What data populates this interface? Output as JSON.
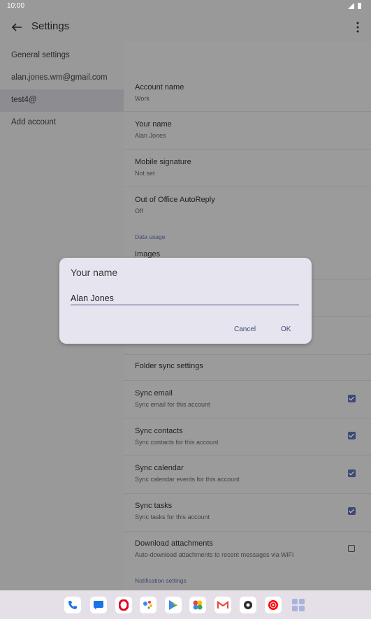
{
  "status": {
    "time": "10:00"
  },
  "appbar": {
    "title": "Settings"
  },
  "nav": {
    "items": [
      {
        "label": "General settings"
      },
      {
        "label": "alan.jones.wm@gmail.com"
      },
      {
        "label": "test4@"
      },
      {
        "label": "Add account"
      }
    ]
  },
  "settings": {
    "account_name": {
      "title": "Account name",
      "value": "Work"
    },
    "your_name": {
      "title": "Your name",
      "value": "Alan Jones"
    },
    "signature": {
      "title": "Mobile signature",
      "value": "Not set"
    },
    "autoreply": {
      "title": "Out of Office AutoReply",
      "value": "Off"
    },
    "data_usage_header": "Data usage",
    "images": {
      "title": "Images"
    },
    "folder_sync": {
      "title": "Folder sync settings"
    },
    "sync_email": {
      "title": "Sync email",
      "sub": "Sync email for this account",
      "checked": true
    },
    "sync_contacts": {
      "title": "Sync contacts",
      "sub": "Sync contacts for this account",
      "checked": true
    },
    "sync_calendar": {
      "title": "Sync calendar",
      "sub": "Sync calendar events for this account",
      "checked": true
    },
    "sync_tasks": {
      "title": "Sync tasks",
      "sub": "Sync tasks for this account",
      "checked": true
    },
    "download_attachments": {
      "title": "Download attachments",
      "sub": "Auto-download attachments to recent messages via WiFi",
      "checked": false
    },
    "notification_header": "Notification settings"
  },
  "dialog": {
    "title": "Your name",
    "input_value": "Alan Jones",
    "cancel_label": "Cancel",
    "ok_label": "OK"
  },
  "dock": {
    "apps": [
      "phone-icon",
      "messages-icon",
      "opera-icon",
      "assistant-icon",
      "play-store-icon",
      "photos-icon",
      "gmail-icon",
      "settings-icon",
      "youtube-music-icon",
      "app-drawer-icon"
    ]
  },
  "colors": {
    "accent": "#3f4a73",
    "dialog_bg": "#e6e5ef",
    "scrim": "#999999"
  }
}
